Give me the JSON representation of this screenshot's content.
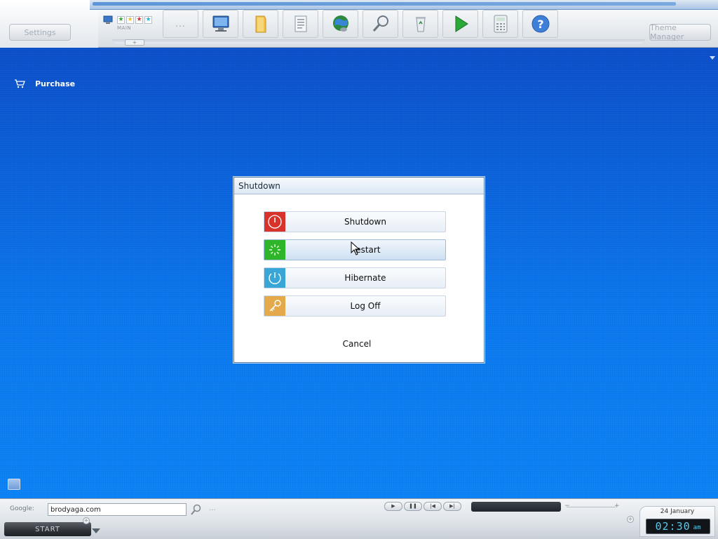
{
  "top": {
    "settings_label": "Settings",
    "theme_manager_label": "Theme Manager",
    "main_label": "MAIN",
    "tab_add_label": "+",
    "more_label": "...",
    "toolbar_icons": [
      "dots",
      "computer-icon",
      "folder-icon",
      "documents-icon",
      "internet-globe-icon",
      "search-icon",
      "recycle-bin-icon",
      "run-play-icon",
      "calculator-icon",
      "help-icon"
    ]
  },
  "desktop": {
    "purchase_label": "Purchase"
  },
  "dialog": {
    "title": "Shutdown",
    "actions": [
      {
        "label": "Shutdown",
        "icon": "power-icon",
        "color": "#d8332b"
      },
      {
        "label": "Restart",
        "icon": "restart-icon",
        "color": "#2fb52a"
      },
      {
        "label": "Hibernate",
        "icon": "hibernate-icon",
        "color": "#3aa6d6"
      },
      {
        "label": "Log Off",
        "icon": "key-icon",
        "color": "#e4a94a"
      }
    ],
    "cancel_label": "Cancel"
  },
  "bottom": {
    "google_label": "Google:",
    "google_value": "brodyaga.com",
    "more_label": "...",
    "start_label": "START",
    "media_buttons": [
      "▶",
      "❚❚",
      "|◀",
      "▶|"
    ],
    "date": "24 January",
    "time": "02:30",
    "ampm": "am"
  }
}
